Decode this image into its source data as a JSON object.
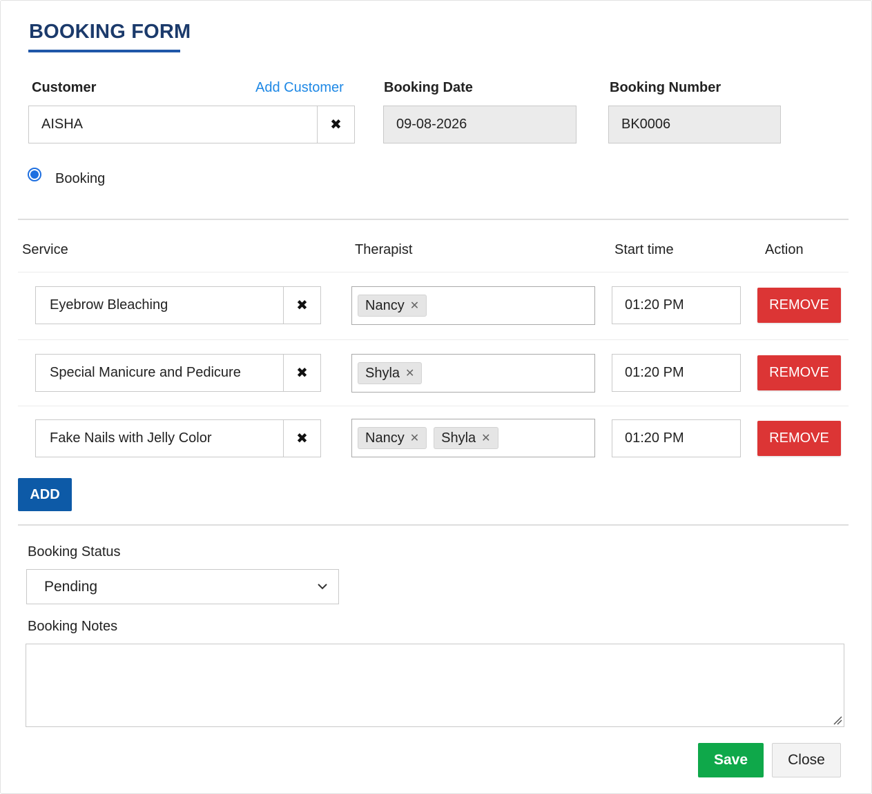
{
  "form": {
    "title": "BOOKING FORM"
  },
  "customer": {
    "label": "Customer",
    "add_link": "Add Customer",
    "value": "AISHA",
    "clear_glyph": "✖"
  },
  "booking_date": {
    "label": "Booking Date",
    "value": "09-08-2026"
  },
  "booking_number": {
    "label": "Booking Number",
    "value": "BK0006"
  },
  "booking_type": {
    "label": "Booking",
    "selected": true
  },
  "table": {
    "headers": {
      "service": "Service",
      "therapist": "Therapist",
      "start_time": "Start time",
      "action": "Action"
    },
    "rows": [
      {
        "service": "Eyebrow Bleaching",
        "therapists": [
          "Nancy"
        ],
        "start_time": "01:20 PM",
        "action_label": "REMOVE"
      },
      {
        "service": "Special Manicure and Pedicure",
        "therapists": [
          "Shyla"
        ],
        "start_time": "01:20 PM",
        "action_label": "REMOVE"
      },
      {
        "service": "Fake Nails with Jelly Color",
        "therapists": [
          "Nancy",
          "Shyla"
        ],
        "start_time": "01:20 PM",
        "action_label": "REMOVE"
      }
    ],
    "tag_remove_glyph": "✕",
    "clear_glyph": "✖"
  },
  "add_button": "ADD",
  "booking_status": {
    "label": "Booking Status",
    "value": "Pending"
  },
  "booking_notes": {
    "label": "Booking Notes",
    "value": ""
  },
  "footer": {
    "save": "Save",
    "close": "Close"
  },
  "colors": {
    "title": "#1b3a6b",
    "link": "#1e88e5",
    "remove": "#dc3535",
    "add": "#0d5aa7",
    "save": "#0fa84a"
  }
}
